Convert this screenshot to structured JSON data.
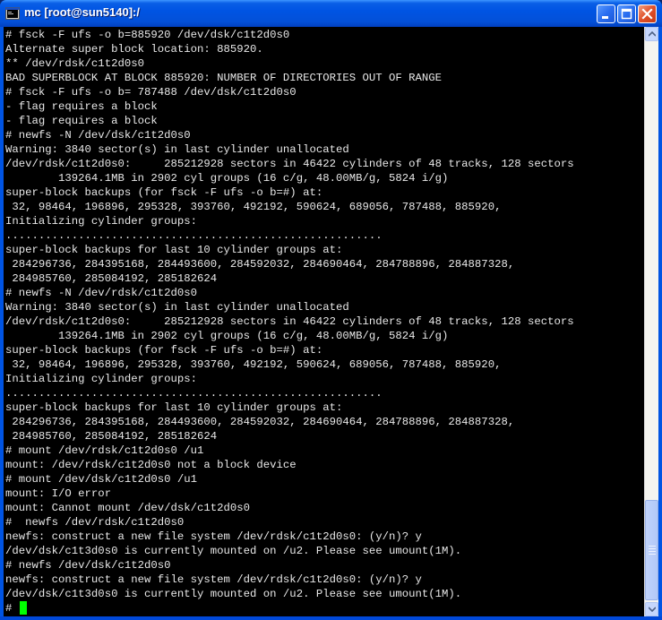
{
  "window": {
    "title": "mc [root@sun5140]:/"
  },
  "terminal": {
    "lines": [
      "# fsck -F ufs -o b=885920 /dev/dsk/c1t2d0s0",
      "Alternate super block location: 885920.",
      "** /dev/rdsk/c1t2d0s0",
      "BAD SUPERBLOCK AT BLOCK 885920: NUMBER OF DIRECTORIES OUT OF RANGE",
      "# fsck -F ufs -o b= 787488 /dev/dsk/c1t2d0s0",
      "- flag requires a block",
      "- flag requires a block",
      "# newfs -N /dev/dsk/c1t2d0s0",
      "Warning: 3840 sector(s) in last cylinder unallocated",
      "/dev/rdsk/c1t2d0s0:     285212928 sectors in 46422 cylinders of 48 tracks, 128 sectors",
      "        139264.1MB in 2902 cyl groups (16 c/g, 48.00MB/g, 5824 i/g)",
      "super-block backups (for fsck -F ufs -o b=#) at:",
      " 32, 98464, 196896, 295328, 393760, 492192, 590624, 689056, 787488, 885920,",
      "Initializing cylinder groups:",
      ".........................................................",
      "super-block backups for last 10 cylinder groups at:",
      " 284296736, 284395168, 284493600, 284592032, 284690464, 284788896, 284887328,",
      " 284985760, 285084192, 285182624",
      "# newfs -N /dev/rdsk/c1t2d0s0",
      "Warning: 3840 sector(s) in last cylinder unallocated",
      "/dev/rdsk/c1t2d0s0:     285212928 sectors in 46422 cylinders of 48 tracks, 128 sectors",
      "        139264.1MB in 2902 cyl groups (16 c/g, 48.00MB/g, 5824 i/g)",
      "super-block backups (for fsck -F ufs -o b=#) at:",
      " 32, 98464, 196896, 295328, 393760, 492192, 590624, 689056, 787488, 885920,",
      "Initializing cylinder groups:",
      ".........................................................",
      "super-block backups for last 10 cylinder groups at:",
      " 284296736, 284395168, 284493600, 284592032, 284690464, 284788896, 284887328,",
      " 284985760, 285084192, 285182624",
      "# mount /dev/rdsk/c1t2d0s0 /u1",
      "mount: /dev/rdsk/c1t2d0s0 not a block device",
      "# mount /dev/dsk/c1t2d0s0 /u1",
      "mount: I/O error",
      "mount: Cannot mount /dev/dsk/c1t2d0s0",
      "#  newfs /dev/rdsk/c1t2d0s0",
      "newfs: construct a new file system /dev/rdsk/c1t2d0s0: (y/n)? y",
      "/dev/dsk/c1t3d0s0 is currently mounted on /u2. Please see umount(1M).",
      "# newfs /dev/dsk/c1t2d0s0",
      "newfs: construct a new file system /dev/rdsk/c1t2d0s0: (y/n)? y",
      "/dev/dsk/c1t3d0s0 is currently mounted on /u2. Please see umount(1M)."
    ],
    "prompt": "# ",
    "text_color": "#e8e8e8",
    "cursor_color": "#00ff00"
  }
}
